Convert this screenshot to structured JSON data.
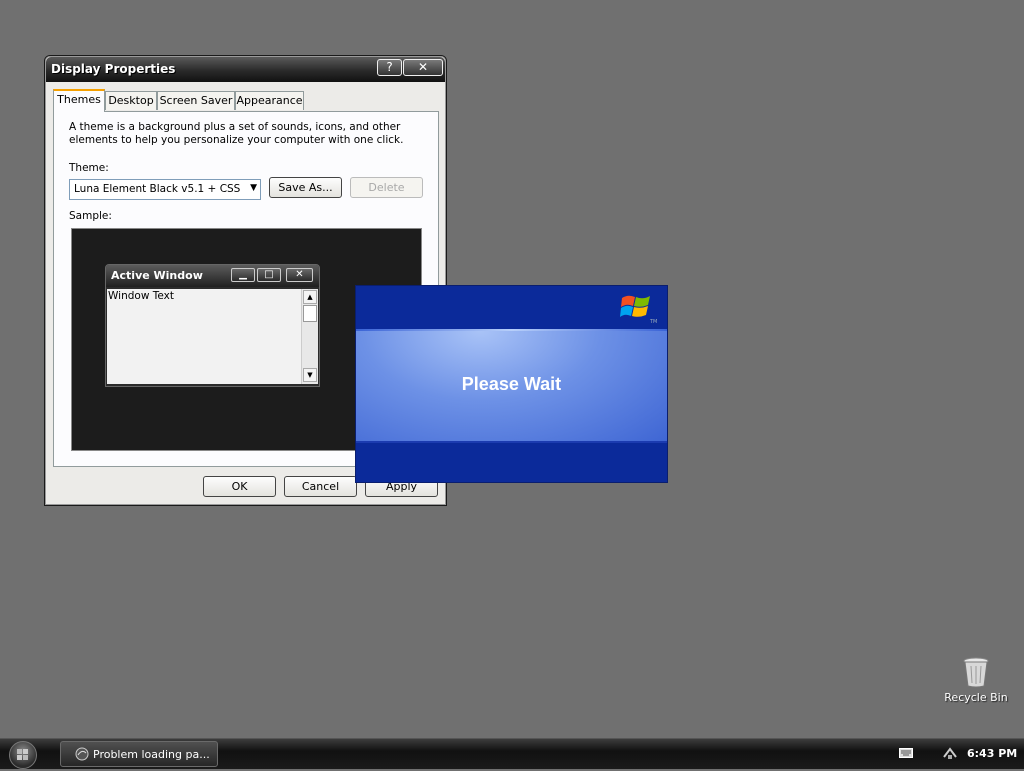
{
  "dialog": {
    "title": "Display Properties",
    "help_button": "?",
    "close_button": "✕",
    "tabs": [
      {
        "label": "Themes",
        "active": true
      },
      {
        "label": "Desktop",
        "active": false
      },
      {
        "label": "Screen Saver",
        "active": false
      },
      {
        "label": "Appearance",
        "active": false
      }
    ],
    "description": "A theme is a background plus a set of sounds, icons, and other elements to help you personalize your computer with one click.",
    "theme_label": "Theme:",
    "theme_value": "Luna Element Black v5.1 + CSS",
    "save_as_button": "Save As...",
    "delete_button": "Delete",
    "sample_label": "Sample:",
    "sample_window": {
      "title": "Active Window",
      "body_text": "Window Text"
    },
    "ok_button": "OK",
    "cancel_button": "Cancel",
    "apply_button": "Apply"
  },
  "splash": {
    "text": "Please Wait",
    "tm": "TM"
  },
  "desktop": {
    "recycle_bin_label": "Recycle Bin"
  },
  "taskbar": {
    "task_label": "Problem loading pa...",
    "clock": "6:43 PM"
  },
  "colors": {
    "desktop_bg": "#707070",
    "splash_blue": "#0b2a9a",
    "taskbar_bg": "#1a1a1a"
  },
  "icons": {
    "start": "windows-orb-icon",
    "task": "firefox-icon",
    "keyboard": "keyboard-icon",
    "network": "network-icon",
    "recycle": "recycle-bin-icon"
  }
}
